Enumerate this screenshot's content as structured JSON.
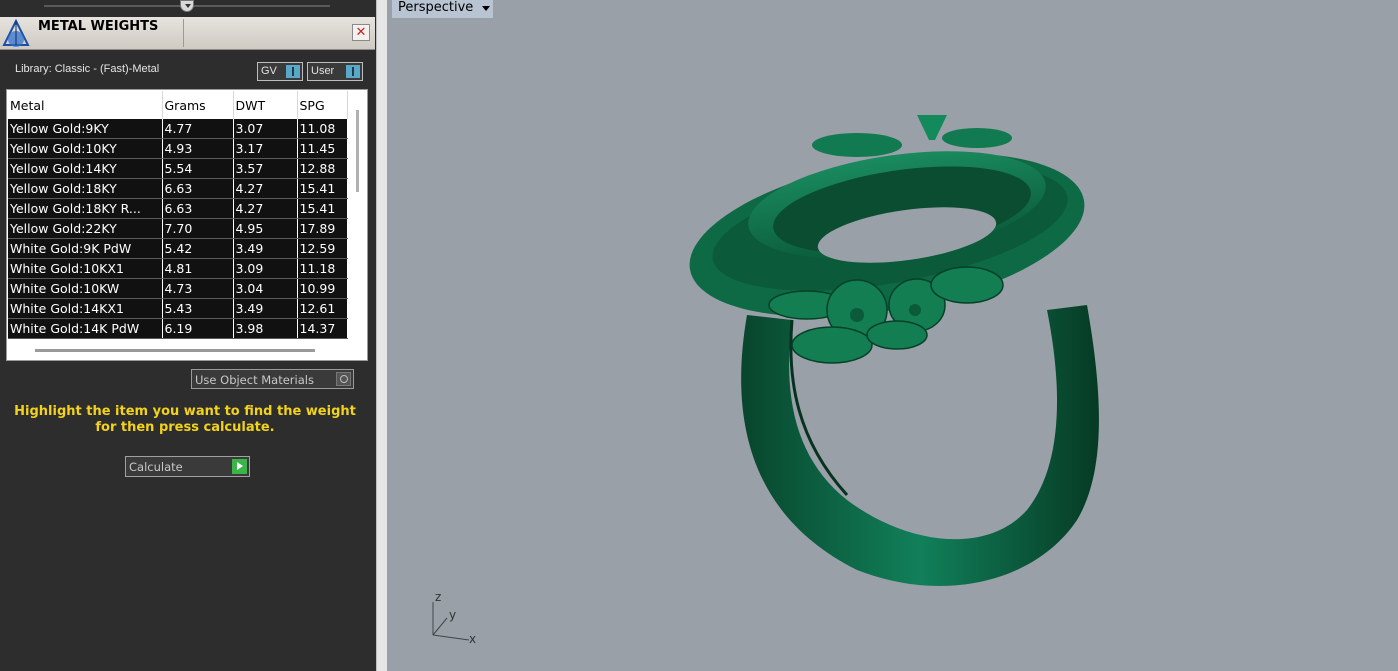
{
  "panel": {
    "title": "METAL WEIGHTS",
    "close_symbol": "✕",
    "library_label": "Library: Classic - (Fast)-Metal",
    "toggles": {
      "gv": "GV",
      "user": "User"
    },
    "columns": [
      "Metal",
      "Grams",
      "DWT",
      "SPG"
    ],
    "rows": [
      [
        "Yellow Gold:9KY",
        "4.77",
        "3.07",
        "11.08"
      ],
      [
        "Yellow Gold:10KY",
        "4.93",
        "3.17",
        "11.45"
      ],
      [
        "Yellow Gold:14KY",
        "5.54",
        "3.57",
        "12.88"
      ],
      [
        "Yellow Gold:18KY",
        "6.63",
        "4.27",
        "15.41"
      ],
      [
        "Yellow Gold:18KY R...",
        "6.63",
        "4.27",
        "15.41"
      ],
      [
        "Yellow Gold:22KY",
        "7.70",
        "4.95",
        "17.89"
      ],
      [
        "White Gold:9K PdW",
        "5.42",
        "3.49",
        "12.59"
      ],
      [
        "White Gold:10KX1",
        "4.81",
        "3.09",
        "11.18"
      ],
      [
        "White Gold:10KW",
        "4.73",
        "3.04",
        "10.99"
      ],
      [
        "White Gold:14KX1",
        "5.43",
        "3.49",
        "12.61"
      ],
      [
        "White Gold:14K PdW",
        "6.19",
        "3.98",
        "14.37"
      ]
    ],
    "use_object_materials": "Use Object Materials",
    "instruction": "Highlight the item you want to find the weight for then press calculate.",
    "calculate": "Calculate"
  },
  "viewport": {
    "label": "Perspective",
    "axes": {
      "x": "x",
      "y": "y",
      "z": "z"
    }
  },
  "colors": {
    "panel_bg": "#2d2d2d",
    "viewport_bg": "#9aa0a8",
    "ring_green": "#0f6b45",
    "instruction_yellow": "#f2d21a"
  }
}
